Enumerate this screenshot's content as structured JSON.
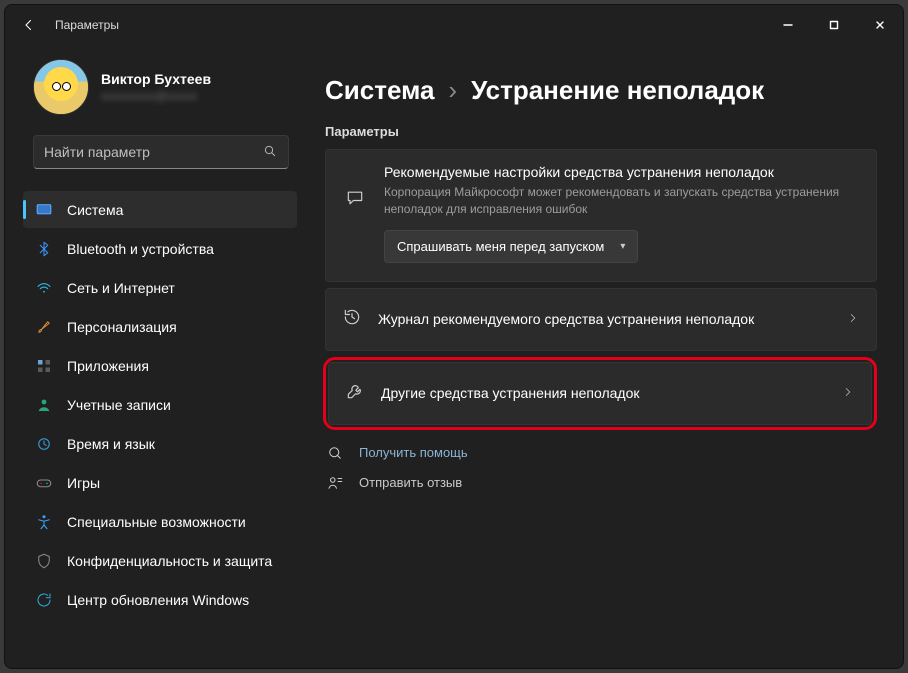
{
  "titlebar": {
    "title": "Параметры"
  },
  "user": {
    "name": "Виктор Бухтеев",
    "email_masked": "xxxxxxxxx@xxxxx"
  },
  "search": {
    "placeholder": "Найти параметр"
  },
  "sidebar": {
    "items": [
      {
        "label": "Система",
        "icon": "system"
      },
      {
        "label": "Bluetooth и устройства",
        "icon": "bluetooth"
      },
      {
        "label": "Сеть и Интернет",
        "icon": "wifi"
      },
      {
        "label": "Персонализация",
        "icon": "brush"
      },
      {
        "label": "Приложения",
        "icon": "apps"
      },
      {
        "label": "Учетные записи",
        "icon": "account"
      },
      {
        "label": "Время и язык",
        "icon": "time"
      },
      {
        "label": "Игры",
        "icon": "games"
      },
      {
        "label": "Специальные возможности",
        "icon": "accessibility"
      },
      {
        "label": "Конфиденциальность и защита",
        "icon": "privacy"
      },
      {
        "label": "Центр обновления Windows",
        "icon": "update"
      }
    ]
  },
  "breadcrumb": {
    "root": "Система",
    "current": "Устранение неполадок",
    "sep": "›"
  },
  "section_label": "Параметры",
  "recommended_panel": {
    "title": "Рекомендуемые настройки средства устранения неполадок",
    "subtitle": "Корпорация Майкрософт может рекомендовать и запускать средства устранения неполадок для исправления ошибок",
    "combo_value": "Спрашивать меня перед запуском"
  },
  "rows": {
    "history": "Журнал рекомендуемого средства устранения неполадок",
    "other": "Другие средства устранения неполадок"
  },
  "footer": {
    "help": "Получить помощь",
    "feedback": "Отправить отзыв"
  }
}
